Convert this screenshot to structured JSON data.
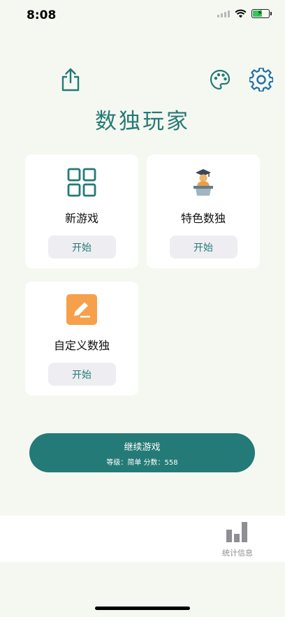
{
  "status_bar": {
    "time": "8:08",
    "battery_level": 0.6,
    "battery_color": "#34c759"
  },
  "header": {
    "title": "数独玩家",
    "share_icon": "share-icon",
    "palette_icon": "palette-icon",
    "settings_icon": "gear-icon"
  },
  "cards": [
    {
      "label": "新游戏",
      "button": "开始",
      "icon": "grid-icon"
    },
    {
      "label": "特色数独",
      "button": "开始",
      "icon": "graduate-lectern-icon"
    },
    {
      "label": "自定义数独",
      "button": "开始",
      "icon": "edit-pencil-icon"
    }
  ],
  "continue_game": {
    "title": "继续游戏",
    "subtitle": "等级：简单 分数：558"
  },
  "tab_bar": {
    "stats_label": "统计信息",
    "stats_icon": "bar-chart-icon"
  },
  "colors": {
    "accent": "#247a76",
    "background": "#f5f8f1",
    "card": "#ffffff",
    "button_bg": "#eeeef2",
    "orange": "#f7a04b"
  }
}
